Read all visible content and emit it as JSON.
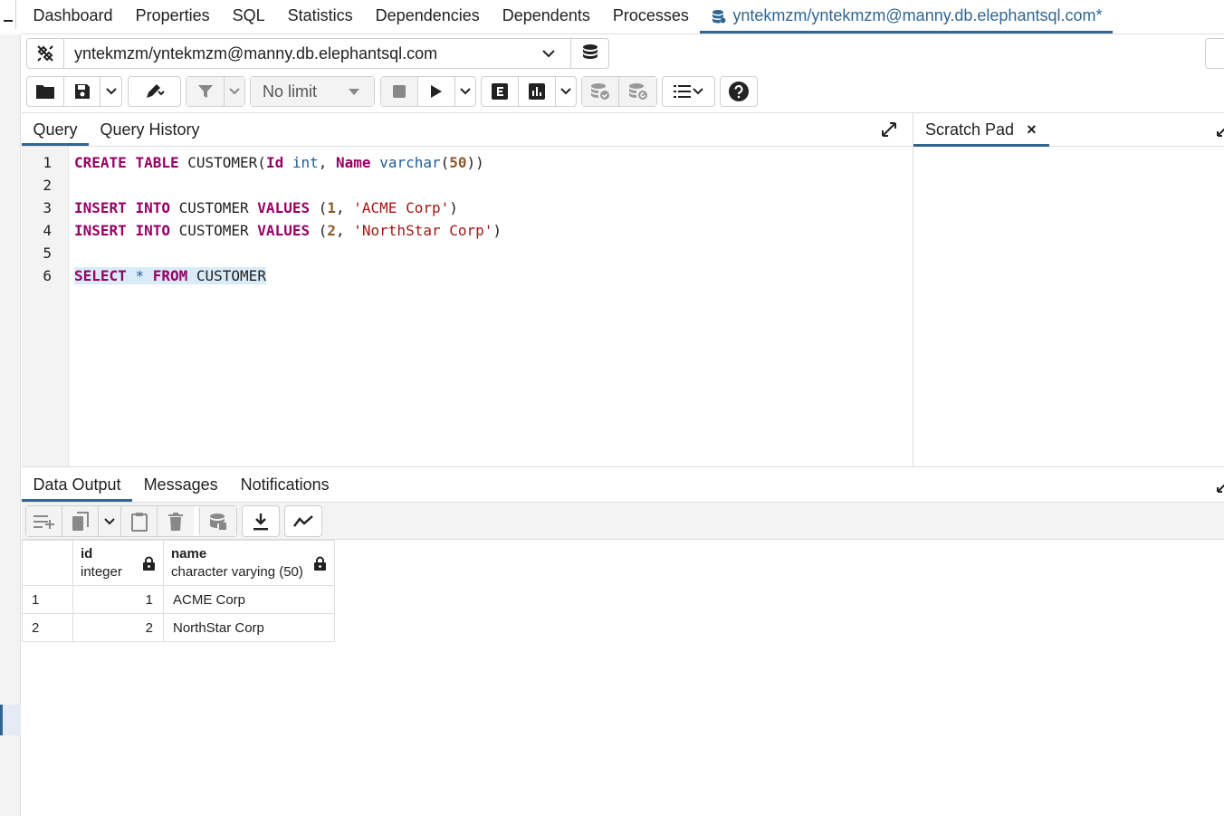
{
  "top_tabs": [
    "Dashboard",
    "Properties",
    "SQL",
    "Statistics",
    "Dependencies",
    "Dependents",
    "Processes"
  ],
  "active_tab": "yntekmzm/yntekmzm@manny.db.elephantsql.com*",
  "connection": {
    "name": "yntekmzm/yntekmzm@manny.db.elephantsql.com"
  },
  "toolbar": {
    "limit_label": "No limit"
  },
  "query_panel": {
    "tabs": [
      "Query",
      "Query History"
    ]
  },
  "scratch_pad": {
    "label": "Scratch Pad",
    "close": "×"
  },
  "editor": {
    "line_numbers": [
      "1",
      "2",
      "3",
      "4",
      "5",
      "6"
    ],
    "code": [
      "CREATE TABLE CUSTOMER(Id int, Name varchar(50))",
      "",
      "INSERT INTO CUSTOMER VALUES (1, 'ACME Corp')",
      "INSERT INTO CUSTOMER VALUES (2, 'NorthStar Corp')",
      "",
      "SELECT * FROM CUSTOMER"
    ]
  },
  "output_panel": {
    "tabs": [
      "Data Output",
      "Messages",
      "Notifications"
    ]
  },
  "result_grid": {
    "columns": [
      {
        "name": "id",
        "type": "integer"
      },
      {
        "name": "name",
        "type": "character varying (50)"
      }
    ],
    "rows": [
      {
        "num": "1",
        "id": "1",
        "name": "ACME Corp"
      },
      {
        "num": "2",
        "id": "2",
        "name": "NorthStar Corp"
      }
    ]
  },
  "colors": {
    "accent": "#326690",
    "keyword": "#990066",
    "type": "#1f5c99",
    "string": "#a31515"
  }
}
